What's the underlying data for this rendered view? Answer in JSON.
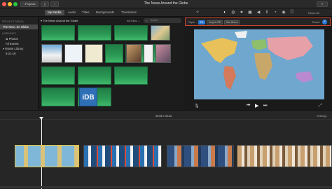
{
  "window": {
    "title": "The News Around the Globe",
    "projects_label": "Projects",
    "reset_all": "Reset All"
  },
  "tabs": [
    "My Media",
    "Audio",
    "Titles",
    "Backgrounds",
    "Transitions"
  ],
  "sidebar": {
    "project_media_header": "PROJECT MEDIA",
    "project_item": "The New...he Globe",
    "libraries_header": "LIBRARIES",
    "items": [
      "Photos",
      "All Events",
      "iMovie Library",
      "5-21-19"
    ]
  },
  "browser": {
    "group_title": "The News Around the Globe",
    "filter": "All Clips",
    "search_placeholder": "Search",
    "idb_label": "iDB"
  },
  "viewer": {
    "style_label": "Style:",
    "style_buttons": [
      "Fit",
      "Crop to Fill",
      "Ken Burns"
    ],
    "reset_label": "Reset"
  },
  "timeline": {
    "current_time": "00:00",
    "separator": "/",
    "total_time": "00:22",
    "settings_label": "Settings"
  },
  "colors": {
    "selection_border": "#d0452c",
    "accent_blue": "#2d7bd8",
    "clip_green": "#2b9a55",
    "timeline_selected": "#e3c23a"
  }
}
